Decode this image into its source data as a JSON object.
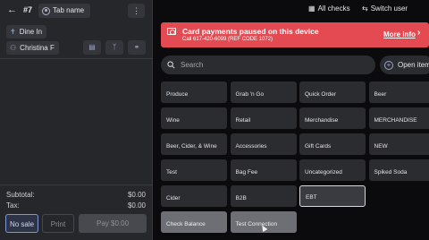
{
  "order": {
    "ticket": "#7",
    "tab_name": "Tab name",
    "dining_option": "Dine In",
    "guest": "Christina F"
  },
  "icons": {
    "back": "arrow-left-icon",
    "more": "more-vertical-icon",
    "user": "user-icon",
    "dining": "utensils-icon",
    "guest": "user-group-icon",
    "receipt": "receipt-icon",
    "split": "split-icon",
    "link": "link-icon",
    "checks": "checks-icon",
    "switch_user": "switch-user-icon",
    "camera_off": "camera-off-icon",
    "search": "search-icon",
    "open_item": "plus-circle-icon"
  },
  "summary": {
    "subtotal_label": "Subtotal:",
    "subtotal_value": "$0.00",
    "tax_label": "Tax:",
    "tax_value": "$0.00"
  },
  "actions": {
    "no_sale": "No sale",
    "print": "Print",
    "pay": "Pay $0.00"
  },
  "header": {
    "all_checks": "All checks",
    "switch_user": "Switch user"
  },
  "banner": {
    "title": "Card payments paused on this device",
    "subtitle": "Call 617-420-6099 (REF CODE 1072)",
    "more": "More info",
    "chevron": "›",
    "color": "#e34a52"
  },
  "search": {
    "placeholder": "Search",
    "open_item": "Open item"
  },
  "menu": {
    "tiles": [
      [
        "Produce",
        "Grab 'n Go",
        "Quick Order",
        "Beer"
      ],
      [
        "Wine",
        "Retail",
        "Merchandise",
        "MERCHANDISE"
      ],
      [
        "Beer, Cider, & Wine",
        "Accessories",
        "Gift Cards",
        "NEW"
      ],
      [
        "Test",
        "Bag Fee",
        "Uncategorized",
        "Spiked Soda"
      ],
      [
        "Cider",
        "B2B",
        "EBT",
        ""
      ],
      [
        "Check Balance",
        "Test Connection",
        "",
        ""
      ]
    ],
    "selected": "EBT"
  }
}
